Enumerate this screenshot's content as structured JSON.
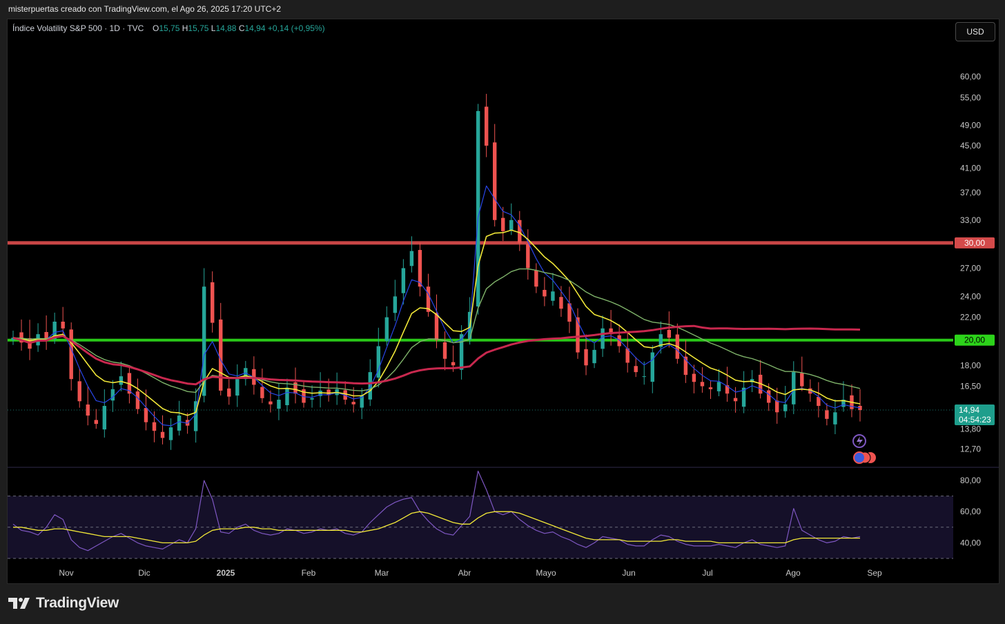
{
  "header": {
    "attribution": "misterpuertas creado con TradingView.com, el Ago 26, 2025 17:20 UTC+2"
  },
  "legend": {
    "symbol": "Índice Volatility S&P 500 · 1D · TVC",
    "o_label": "O",
    "o_value": "15,75",
    "h_label": "H",
    "h_value": "15,75",
    "l_label": "L",
    "l_value": "14,88",
    "c_label": "C",
    "c_value": "14,94",
    "change": "+0,14 (+0,95%)"
  },
  "currency_button": "USD",
  "brand": {
    "name": "TradingView"
  },
  "colors": {
    "background": "#000000",
    "candle_up": "#26a69a",
    "candle_down": "#ef5350",
    "resistance_line": "#d44a4a",
    "support_line": "#2cd31a",
    "ma_blue": "#2846e8",
    "ma_yellow": "#f2e838",
    "ma_green": "#7fb36a",
    "ma_red": "#c8284e",
    "rsi_line": "#7e57c2",
    "rsi_ma": "#f2e838"
  },
  "chart_data": {
    "type": "candlestick",
    "price_axis_ticks": [
      "60,00",
      "55,00",
      "49,00",
      "45,00",
      "41,00",
      "37,00",
      "33,00",
      "27,00",
      "24,00",
      "22,00",
      "18,00",
      "16,50",
      "13,80",
      "12,70"
    ],
    "price_axis_scale": "log",
    "price_range": [
      11.8,
      66
    ],
    "x_axis_labels": [
      "Nov",
      "Dic",
      "2025",
      "Feb",
      "Mar",
      "Abr",
      "Mayo",
      "Jun",
      "Jul",
      "Ago",
      "Sep"
    ],
    "horizontal_levels": [
      {
        "value": 30.0,
        "label": "30,00",
        "color": "#d44a4a"
      },
      {
        "value": 20.0,
        "label": "20,00",
        "color": "#2cd31a"
      }
    ],
    "last_price": {
      "value": 14.94,
      "label": "14,94",
      "countdown": "04:54:23"
    },
    "close_series": [
      20.2,
      19.8,
      19.3,
      20.5,
      20.0,
      21.6,
      21.0,
      17.0,
      15.5,
      14.6,
      14.1,
      15.2,
      16.3,
      17.2,
      16.0,
      15.0,
      14.2,
      13.7,
      13.3,
      13.9,
      14.6,
      14.0,
      15.5,
      25.0,
      21.5,
      16.2,
      15.8,
      17.0,
      17.8,
      16.6,
      15.7,
      15.3,
      15.6,
      16.4,
      16.0,
      15.4,
      15.7,
      16.2,
      15.9,
      16.3,
      15.6,
      15.3,
      15.9,
      17.5,
      19.5,
      22.0,
      24.0,
      27.0,
      29.0,
      25.0,
      22.5,
      20.0,
      18.5,
      18.0,
      20.5,
      22.5,
      52.0,
      45.0,
      33.0,
      31.5,
      33.0,
      30.0,
      27.0,
      25.0,
      24.0,
      24.5,
      22.8,
      21.6,
      19.0,
      18.0,
      19.2,
      21.0,
      20.5,
      19.5,
      18.2,
      17.5,
      17.2,
      19.0,
      20.5,
      20.2,
      18.5,
      17.3,
      16.8,
      16.5,
      16.3,
      16.8,
      16.0,
      15.5,
      16.4,
      17.0,
      16.0,
      15.4,
      14.8,
      15.3,
      17.5,
      16.5,
      16.0,
      15.2,
      14.4,
      14.8,
      15.6,
      15.0,
      14.94
    ],
    "rsi": {
      "axis_ticks": [
        "80,00",
        "60,00",
        "40,00"
      ],
      "levels": [
        70,
        50,
        30
      ],
      "range": [
        26,
        88
      ],
      "values": [
        52,
        48,
        47,
        45,
        50,
        58,
        55,
        42,
        37,
        35,
        38,
        41,
        44,
        46,
        43,
        40,
        38,
        37,
        36,
        39,
        42,
        40,
        49,
        80,
        68,
        47,
        46,
        50,
        52,
        48,
        46,
        45,
        46,
        49,
        48,
        46,
        47,
        49,
        48,
        49,
        46,
        45,
        47,
        53,
        58,
        63,
        66,
        68,
        69,
        60,
        54,
        49,
        46,
        45,
        51,
        57,
        86,
        74,
        60,
        58,
        60,
        55,
        51,
        48,
        46,
        47,
        44,
        42,
        39,
        37,
        40,
        44,
        43,
        42,
        39,
        38,
        38,
        42,
        45,
        44,
        41,
        39,
        38,
        38,
        38,
        39,
        38,
        37,
        40,
        42,
        39,
        38,
        37,
        38,
        62,
        48,
        45,
        42,
        40,
        41,
        44,
        43,
        44
      ],
      "ma_values": [
        50,
        50,
        49,
        48,
        48,
        49,
        49,
        48,
        47,
        46,
        45,
        44,
        44,
        44,
        44,
        43,
        42,
        41,
        40,
        40,
        40,
        40,
        41,
        45,
        48,
        49,
        49,
        49,
        50,
        50,
        49,
        49,
        48,
        48,
        48,
        48,
        48,
        48,
        48,
        48,
        48,
        47,
        47,
        48,
        49,
        51,
        53,
        56,
        59,
        60,
        59,
        57,
        55,
        53,
        52,
        52,
        56,
        59,
        60,
        60,
        60,
        59,
        57,
        55,
        53,
        51,
        49,
        47,
        45,
        43,
        42,
        42,
        42,
        42,
        41,
        41,
        41,
        41,
        41,
        42,
        42,
        41,
        41,
        41,
        41,
        40,
        40,
        40,
        40,
        40,
        40,
        40,
        40,
        40,
        42,
        43,
        43,
        43,
        43,
        43,
        43,
        43,
        43
      ]
    }
  }
}
